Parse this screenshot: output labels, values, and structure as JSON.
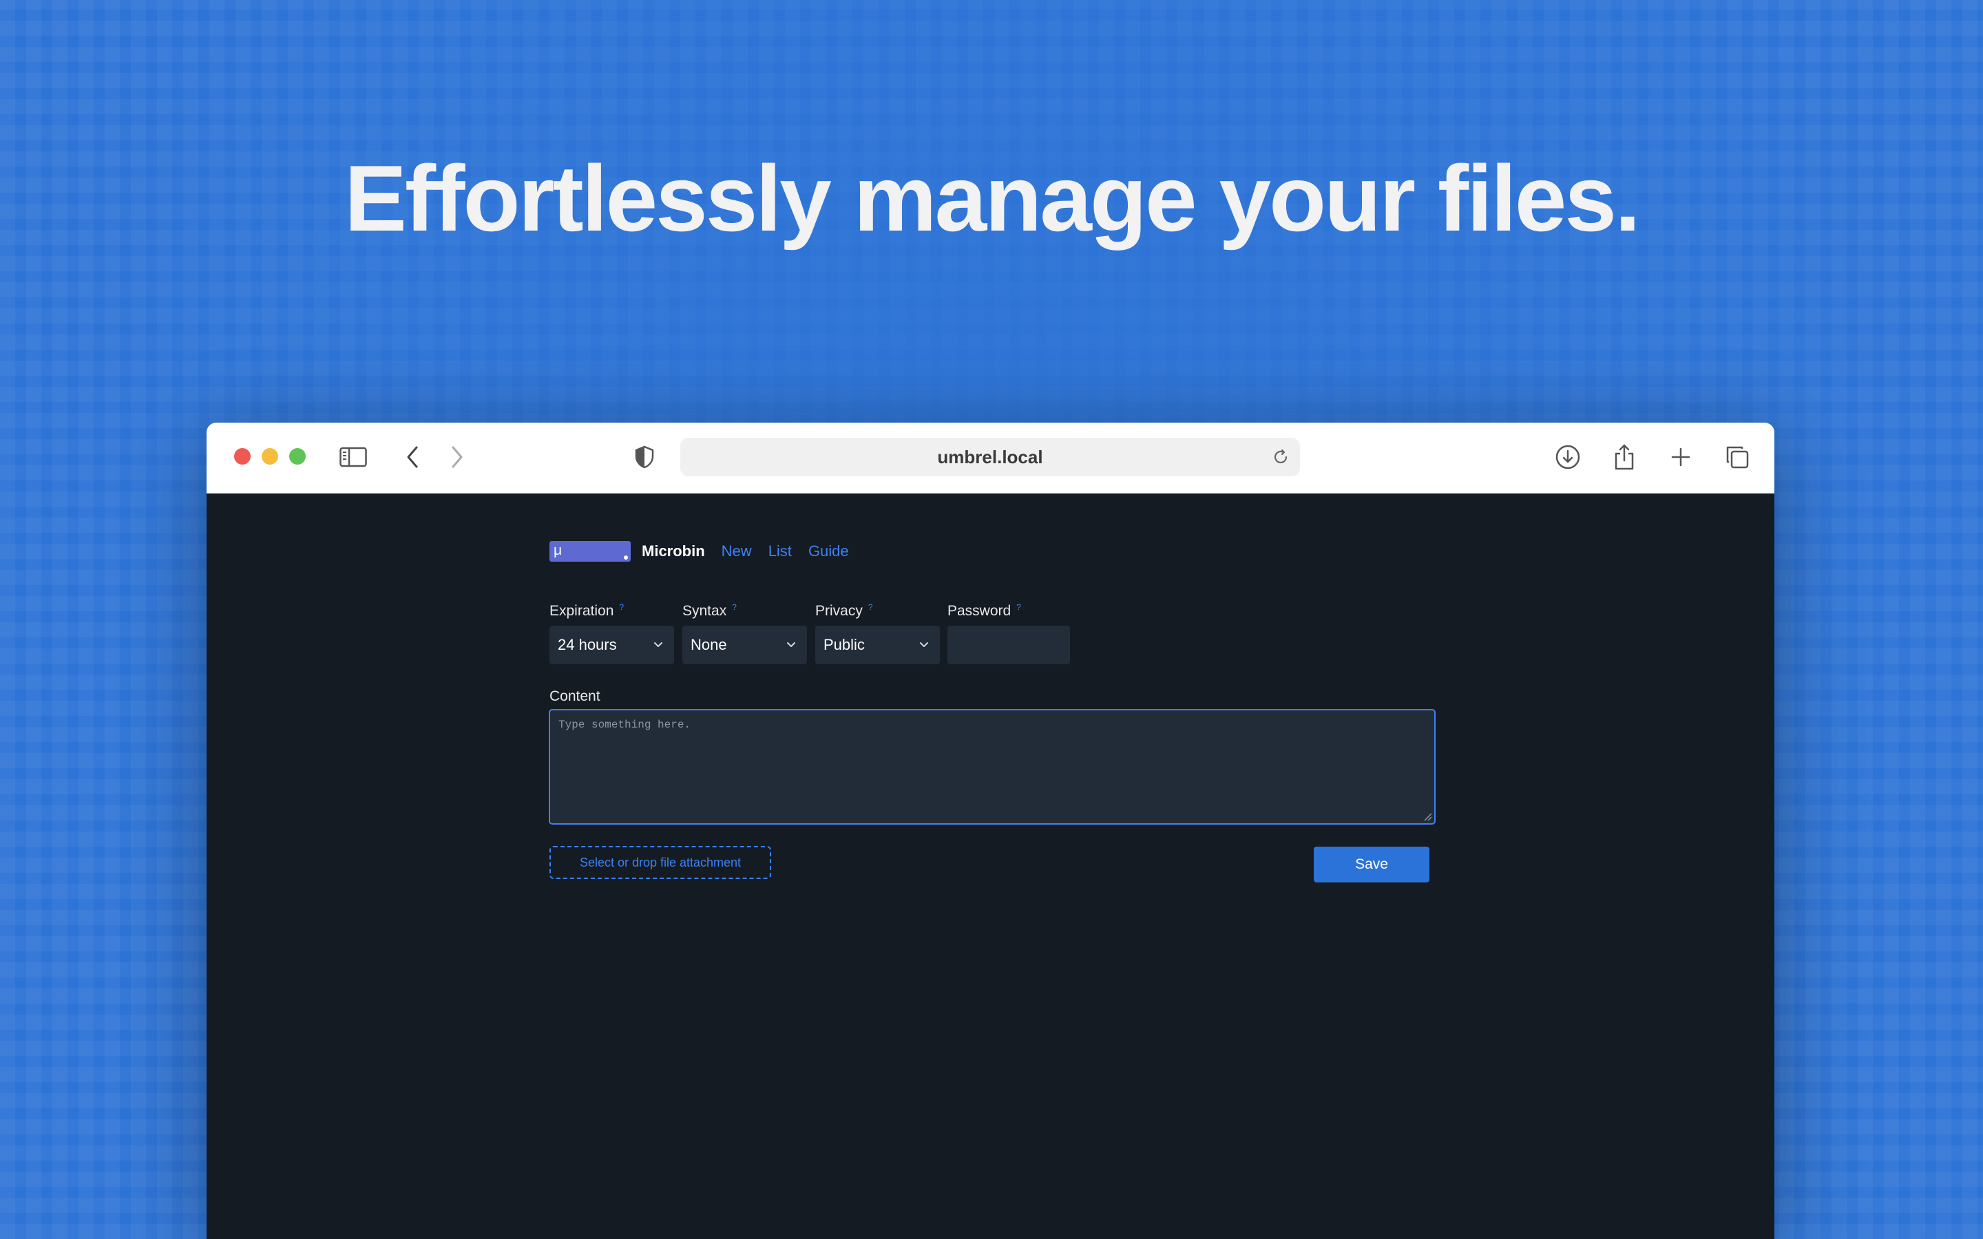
{
  "headline": "Effortlessly manage your files.",
  "browser": {
    "url": "umbrel.local",
    "icons": [
      "close-dot",
      "minimize-dot",
      "zoom-dot",
      "sidebar-icon",
      "back-icon",
      "forward-icon",
      "shield-icon",
      "reload-icon",
      "download-icon",
      "share-icon",
      "new-tab-icon",
      "tabs-overview-icon"
    ]
  },
  "app": {
    "logo_text": "µ",
    "brand": "Microbin",
    "nav": [
      {
        "label": "New"
      },
      {
        "label": "List"
      },
      {
        "label": "Guide"
      }
    ]
  },
  "form": {
    "expiration": {
      "label": "Expiration",
      "hint": "?",
      "value": "24 hours"
    },
    "syntax": {
      "label": "Syntax",
      "hint": "?",
      "value": "None"
    },
    "privacy": {
      "label": "Privacy",
      "hint": "?",
      "value": "Public"
    },
    "password": {
      "label": "Password",
      "hint": "?",
      "value": ""
    },
    "content_label": "Content",
    "content_placeholder": "Type something here.",
    "attach_label": "Select or drop file attachment",
    "save_label": "Save"
  },
  "colors": {
    "background": "#2e74d6",
    "app_bg": "#151b23",
    "accent": "#3b82f6",
    "logo": "#5e6ad2"
  }
}
